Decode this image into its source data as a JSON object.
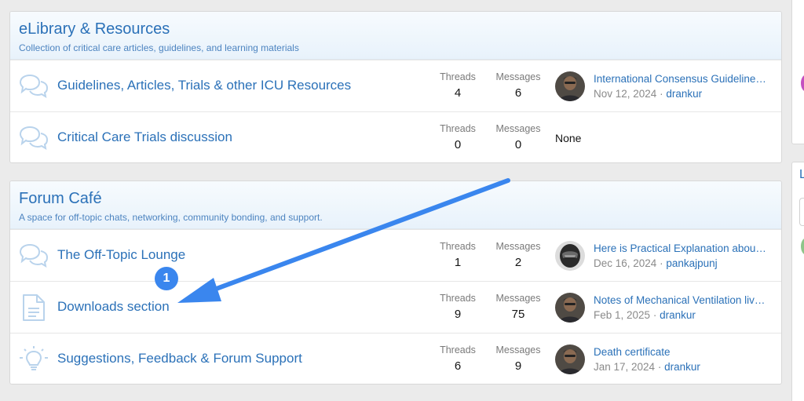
{
  "categories": [
    {
      "title": "eLibrary & Resources",
      "description": "Collection of critical care articles, guidelines, and learning materials",
      "forums": [
        {
          "title": "Guidelines, Articles, Trials & other ICU Resources",
          "icon": "chat-bubbles-icon",
          "threads_label": "Threads",
          "threads": "4",
          "messages_label": "Messages",
          "messages": "6",
          "last_post": {
            "title": "International Consensus Guideline…",
            "date": "Nov 12, 2024",
            "separator": "·",
            "user": "drankur"
          }
        },
        {
          "title": "Critical Care Trials discussion",
          "icon": "chat-bubbles-icon",
          "threads_label": "Threads",
          "threads": "0",
          "messages_label": "Messages",
          "messages": "0",
          "last_post_none": "None"
        }
      ]
    },
    {
      "title": "Forum Café",
      "description": "A space for off-topic chats, networking, community bonding, and support.",
      "forums": [
        {
          "title": "The Off-Topic Lounge",
          "icon": "chat-bubbles-icon",
          "threads_label": "Threads",
          "threads": "1",
          "messages_label": "Messages",
          "messages": "2",
          "last_post": {
            "title": "Here is Practical Explanation abou…",
            "date": "Dec 16, 2024",
            "separator": "·",
            "user": "pankajpunj"
          }
        },
        {
          "title": "Downloads section",
          "icon": "document-icon",
          "threads_label": "Threads",
          "threads": "9",
          "messages_label": "Messages",
          "messages": "75",
          "last_post": {
            "title": "Notes of Mechanical Ventilation liv…",
            "date": "Feb 1, 2025",
            "separator": "·",
            "user": "drankur"
          }
        },
        {
          "title": "Suggestions, Feedback & Forum Support",
          "icon": "lightbulb-icon",
          "threads_label": "Threads",
          "threads": "6",
          "messages_label": "Messages",
          "messages": "9",
          "last_post": {
            "title": "Death certificate",
            "date": "Jan 17, 2024",
            "separator": "·",
            "user": "drankur"
          }
        }
      ]
    }
  ],
  "sidebar": {
    "partial_letter": "L"
  },
  "annotation": {
    "badge_number": "1"
  },
  "colors": {
    "link": "#2b71b8",
    "accent_arrow": "#3a86ee",
    "icon": "#b9d3ec"
  }
}
